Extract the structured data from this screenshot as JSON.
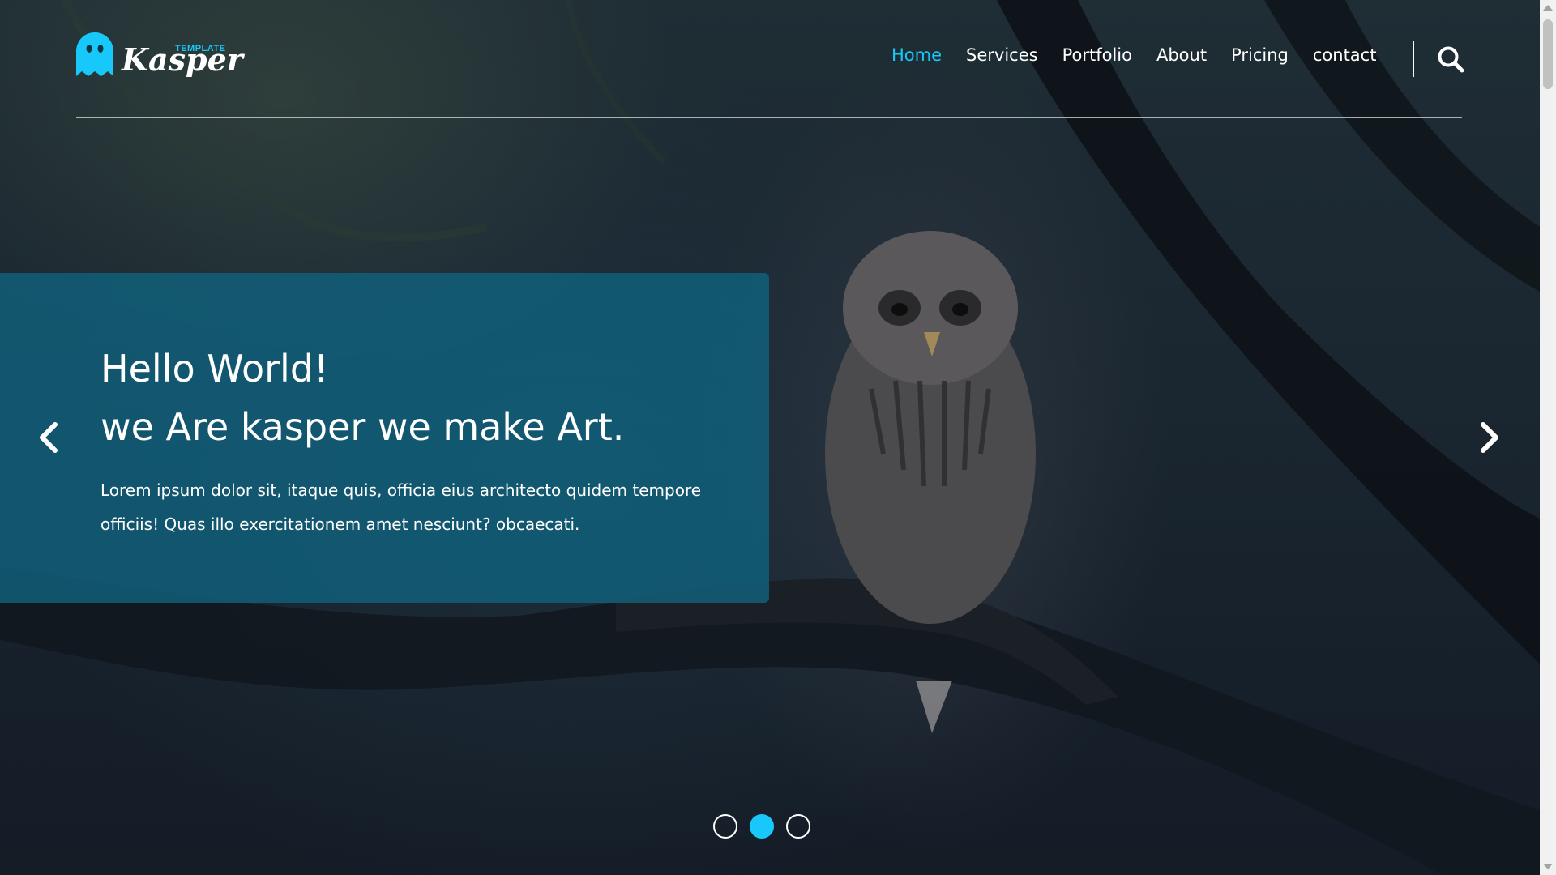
{
  "brand": {
    "name": "Kasper",
    "tag": "TEMPLATE",
    "accent_color": "#19c8fa"
  },
  "nav": {
    "items": [
      {
        "label": "Home",
        "active": true
      },
      {
        "label": "Services",
        "active": false
      },
      {
        "label": "Portfolio",
        "active": false
      },
      {
        "label": "About",
        "active": false
      },
      {
        "label": "Pricing",
        "active": false
      },
      {
        "label": "contact",
        "active": false
      }
    ],
    "search_icon": "search-icon"
  },
  "hero": {
    "title_line1": "Hello World!",
    "title_line2": "we Are kasper we make Art.",
    "text": "Lorem ipsum dolor sit, itaque quis, officia eius architecto quidem tempore officiis! Quas illo exercitationem amet nesciunt? obcaecati.",
    "prev_icon": "chevron-left-icon",
    "next_icon": "chevron-right-icon",
    "slides_total": 3,
    "active_slide": 2
  },
  "colors": {
    "slide_box": "#106480",
    "text": "#ffffff"
  }
}
